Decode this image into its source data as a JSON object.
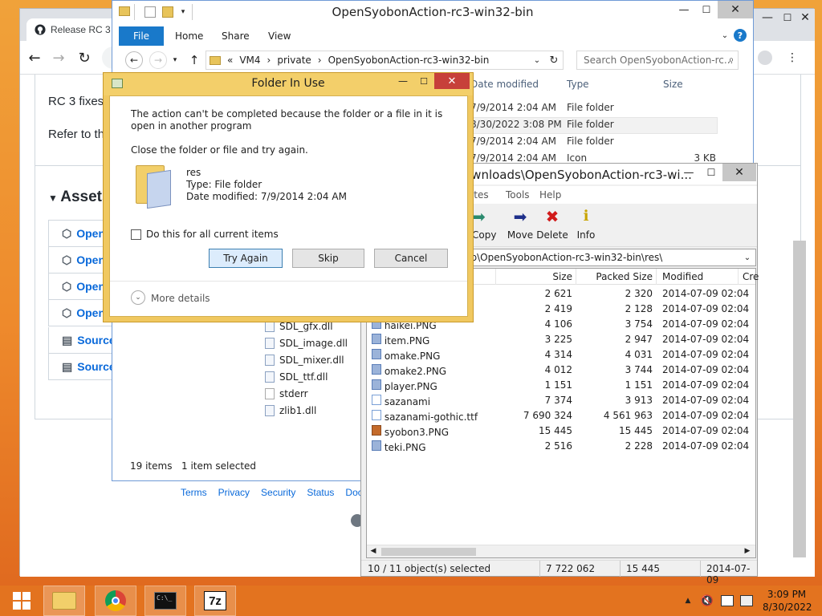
{
  "chrome": {
    "tab_title": "Release RC 3 -",
    "body_line1": "RC 3 fixes",
    "body_line2": "Refer to th",
    "assets_heading": "Assets",
    "asset_rows": [
      "Open",
      "Open",
      "Open",
      "Open",
      "Source",
      "Source"
    ],
    "footer_links": [
      "Terms",
      "Privacy",
      "Security",
      "Status",
      "Doc"
    ]
  },
  "explorer": {
    "title": "OpenSyobonAction-rc3-win32-bin",
    "ribbon_tabs": [
      "File",
      "Home",
      "Share",
      "View"
    ],
    "breadcrumb": [
      "«",
      "VM4",
      "›",
      "private",
      "›",
      "OpenSyobonAction-rc3-win32-bin"
    ],
    "search_placeholder": "Search OpenSyobonAction-rc...",
    "columns": [
      "Date modified",
      "Type",
      "Size"
    ],
    "rows": [
      {
        "date": "7/9/2014 2:04 AM",
        "type": "File folder",
        "size": ""
      },
      {
        "date": "8/30/2022 3:08 PM",
        "type": "File folder",
        "size": ""
      },
      {
        "date": "7/9/2014 2:04 AM",
        "type": "File folder",
        "size": ""
      },
      {
        "date": "7/9/2014 2:04 AM",
        "type": "Icon",
        "size": "3 KB"
      }
    ],
    "files": [
      "SDL_gfx.dll",
      "SDL_image.dll",
      "SDL_mixer.dll",
      "SDL_ttf.dll",
      "stderr",
      "zlib1.dll"
    ],
    "status_count": "19 items",
    "status_selected": "1 item selected"
  },
  "sevenzip": {
    "title": "ownloads\\OpenSyobonAction-rc3-wi...",
    "menu": [
      "rites",
      "Tools",
      "Help"
    ],
    "toolbar": [
      "Copy",
      "Move",
      "Delete",
      "Info"
    ],
    "path": "ction-rc3-win32-bin.zip\\OpenSyobonAction-rc3-win32-bin\\res\\",
    "columns": [
      "Size",
      "Packed Size",
      "Modified",
      "Cre"
    ],
    "rows": [
      {
        "name": "",
        "size": "2 621",
        "packed": "2 320",
        "modified": "2014-07-09 02:04",
        "icon": "png"
      },
      {
        "name": "",
        "size": "2 419",
        "packed": "2 128",
        "modified": "2014-07-09 02:04",
        "icon": "png"
      },
      {
        "name": "haikei.PNG",
        "size": "4 106",
        "packed": "3 754",
        "modified": "2014-07-09 02:04",
        "icon": "png"
      },
      {
        "name": "item.PNG",
        "size": "3 225",
        "packed": "2 947",
        "modified": "2014-07-09 02:04",
        "icon": "png"
      },
      {
        "name": "omake.PNG",
        "size": "4 314",
        "packed": "4 031",
        "modified": "2014-07-09 02:04",
        "icon": "png"
      },
      {
        "name": "omake2.PNG",
        "size": "4 012",
        "packed": "3 744",
        "modified": "2014-07-09 02:04",
        "icon": "png"
      },
      {
        "name": "player.PNG",
        "size": "1 151",
        "packed": "1 151",
        "modified": "2014-07-09 02:04",
        "icon": "png"
      },
      {
        "name": "sazanami",
        "size": "7 374",
        "packed": "3 913",
        "modified": "2014-07-09 02:04",
        "icon": "file"
      },
      {
        "name": "sazanami-gothic.ttf",
        "size": "7 690 324",
        "packed": "4 561 963",
        "modified": "2014-07-09 02:04",
        "icon": "font"
      },
      {
        "name": "syobon3.PNG",
        "size": "15 445",
        "packed": "15 445",
        "modified": "2014-07-09 02:04",
        "icon": "img"
      },
      {
        "name": "teki.PNG",
        "size": "2 516",
        "packed": "2 228",
        "modified": "2014-07-09 02:04",
        "icon": "png"
      }
    ],
    "status_selected": "10 / 11 object(s) selected",
    "status_size": "7 722 062",
    "status_packed": "15 445",
    "status_date": "2014-07-09"
  },
  "dialog": {
    "title": "Folder In Use",
    "message": "The action can't be completed because the folder or a file in it is open in another program",
    "instruction": "Close the folder or file and try again.",
    "item_name": "res",
    "item_type": "Type: File folder",
    "item_date": "Date modified: 7/9/2014 2:04 AM",
    "checkbox_label": "Do this for all current items",
    "try_again": "Try Again",
    "skip": "Skip",
    "cancel": "Cancel",
    "more_details": "More details"
  },
  "taskbar": {
    "time": "3:09 PM",
    "date": "8/30/2022",
    "apps": [
      "file-explorer",
      "chrome",
      "command-prompt",
      "7-zip"
    ]
  },
  "colors": {
    "accent_blue": "#1979ca",
    "dialog_frame": "#f0c860",
    "taskbar": "#e3731f",
    "link_blue": "#0969da"
  }
}
